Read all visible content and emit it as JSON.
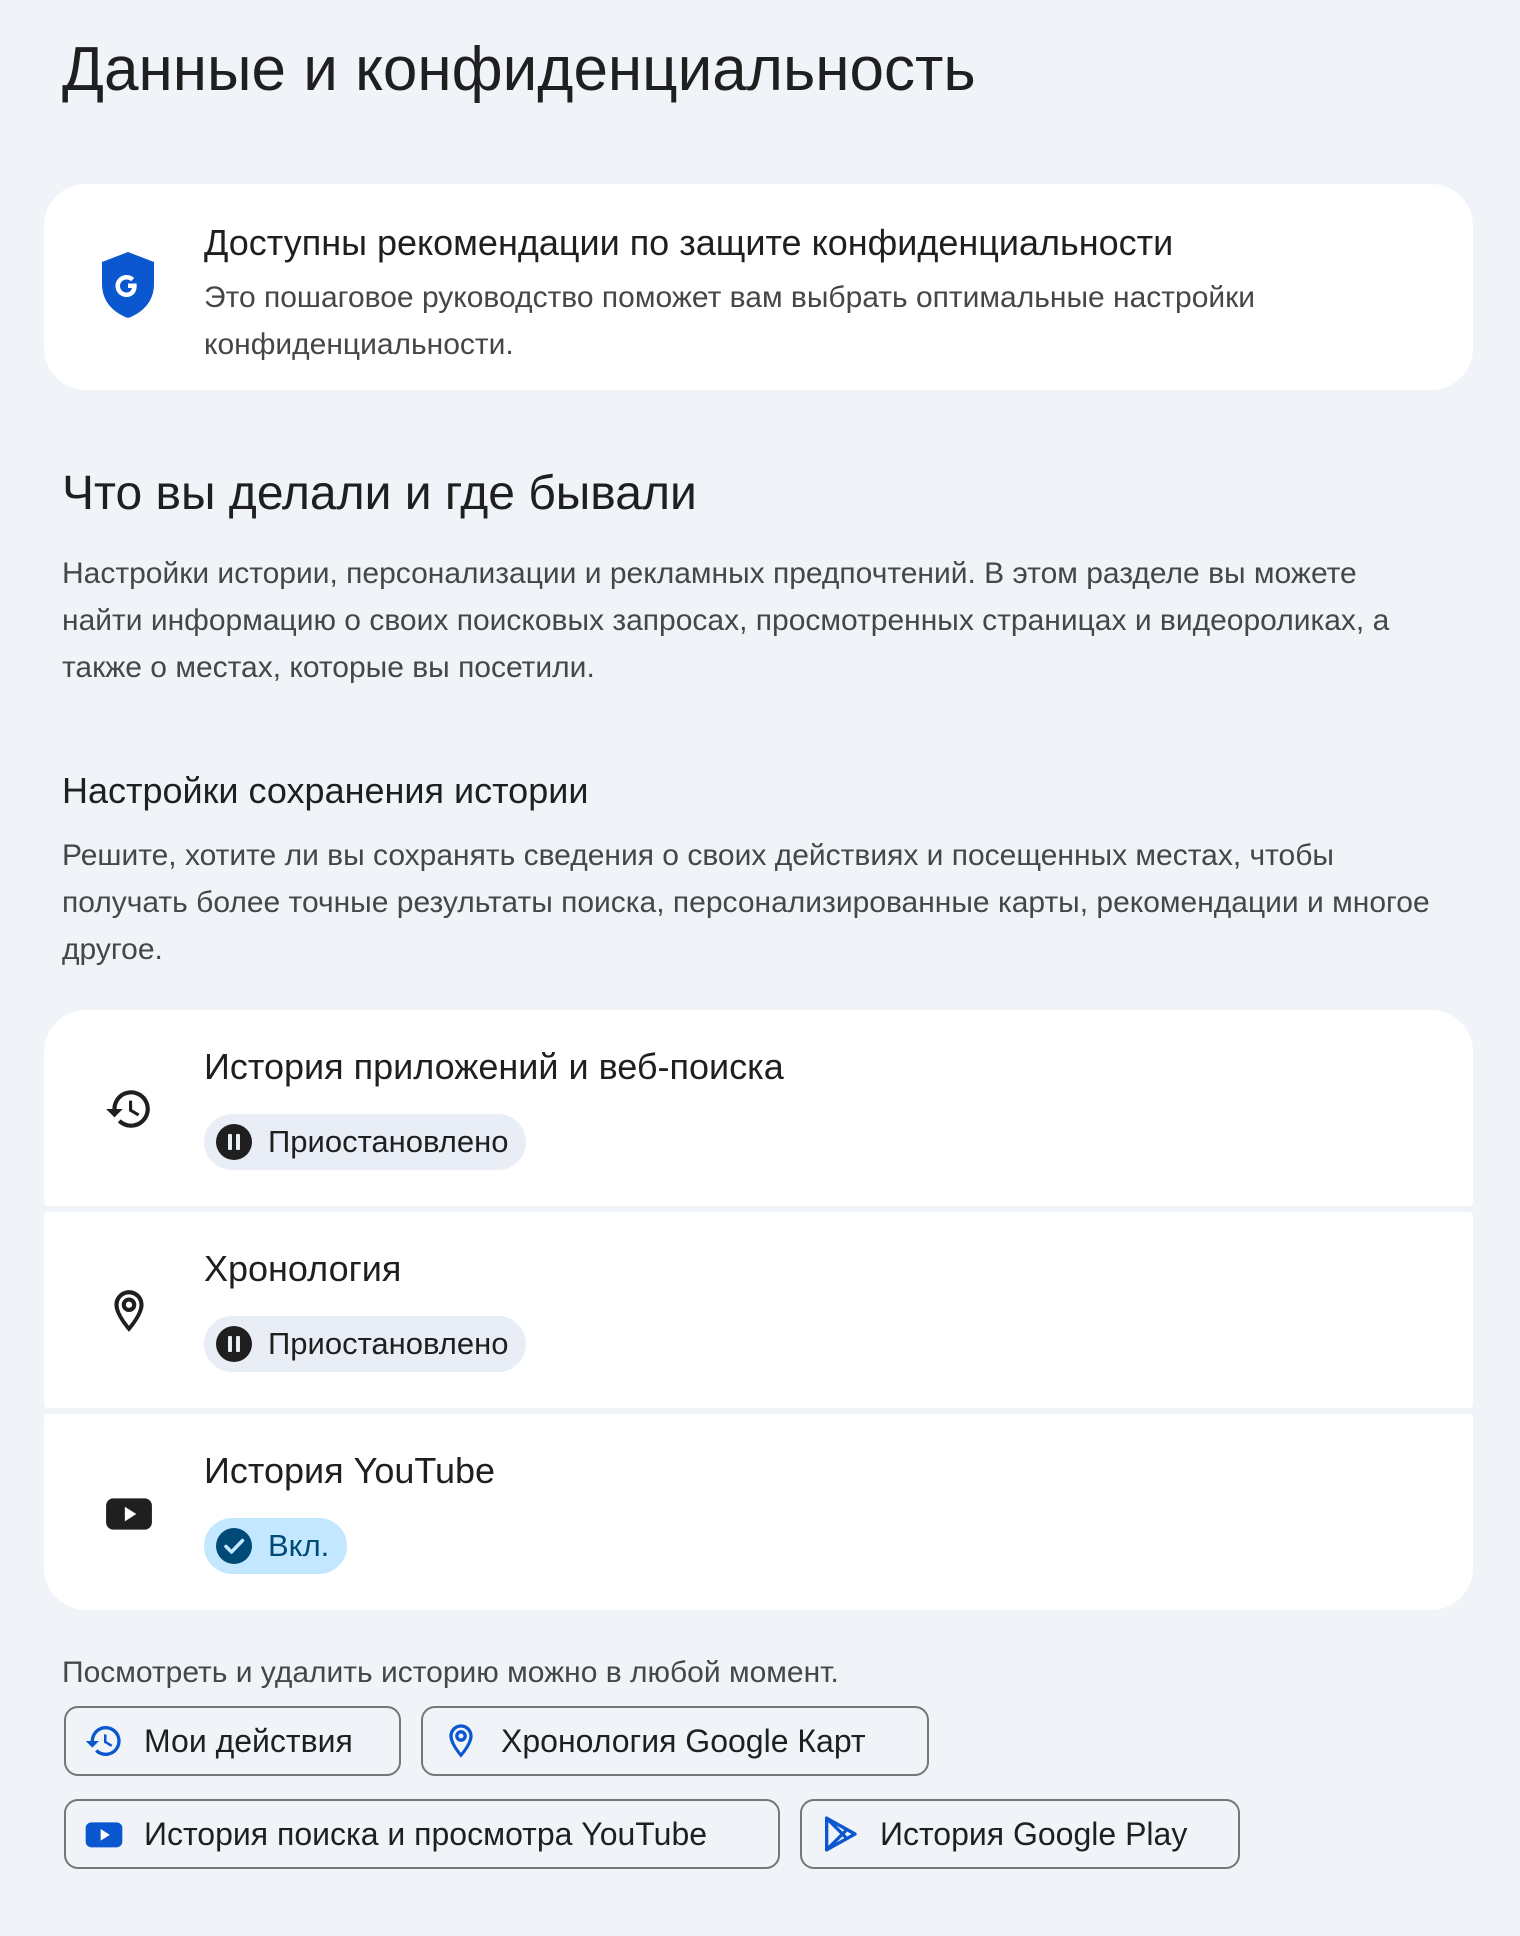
{
  "page": {
    "title": "Данные и конфиденциальность"
  },
  "recommendation": {
    "title": "Доступны рекомендации по защите конфиденциальности",
    "description": "Это пошаговое руководство поможет вам выбрать оптимальные настройки конфиденциальности.",
    "icon": "shield-google-icon",
    "icon_color": "#0b57d0"
  },
  "activity_section": {
    "title": "Что вы делали и где бывали",
    "description": "Настройки истории, персонализации и рекламных предпочтений. В этом разделе вы можете найти информацию о своих поисковых запросах, просмотренных страницах и видеороликах, а также о местах, которые вы посетили."
  },
  "history_settings": {
    "title": "Настройки сохранения истории",
    "description": "Решите, хотите ли вы сохранять сведения о своих действиях и посещенных местах, чтобы получать более точные результаты поиска, персонализированные карты, рекомендации и многое другое.",
    "items": [
      {
        "title": "История приложений и веб-поиска",
        "status": "Приостановлено",
        "state": "paused",
        "icon": "history-icon"
      },
      {
        "title": "Хронология",
        "status": "Приостановлено",
        "state": "paused",
        "icon": "location-pin-icon"
      },
      {
        "title": "История YouTube",
        "status": "Вкл.",
        "state": "on",
        "icon": "youtube-icon"
      }
    ]
  },
  "footer": {
    "note": "Посмотреть и удалить историю можно в любой момент.",
    "links": [
      {
        "label": "Мои действия",
        "icon": "history-icon"
      },
      {
        "label": "Хронология Google Карт",
        "icon": "location-pin-icon"
      },
      {
        "label": "История поиска и просмотра YouTube",
        "icon": "youtube-icon"
      },
      {
        "label": "История Google Play",
        "icon": "google-play-icon"
      }
    ]
  },
  "colors": {
    "background": "#f0f4f9",
    "card": "#ffffff",
    "accent_blue": "#0b57d0",
    "chip_paused_bg": "#e9eef6",
    "chip_on_bg": "#c2e7ff",
    "chip_on_text": "#004a77"
  }
}
